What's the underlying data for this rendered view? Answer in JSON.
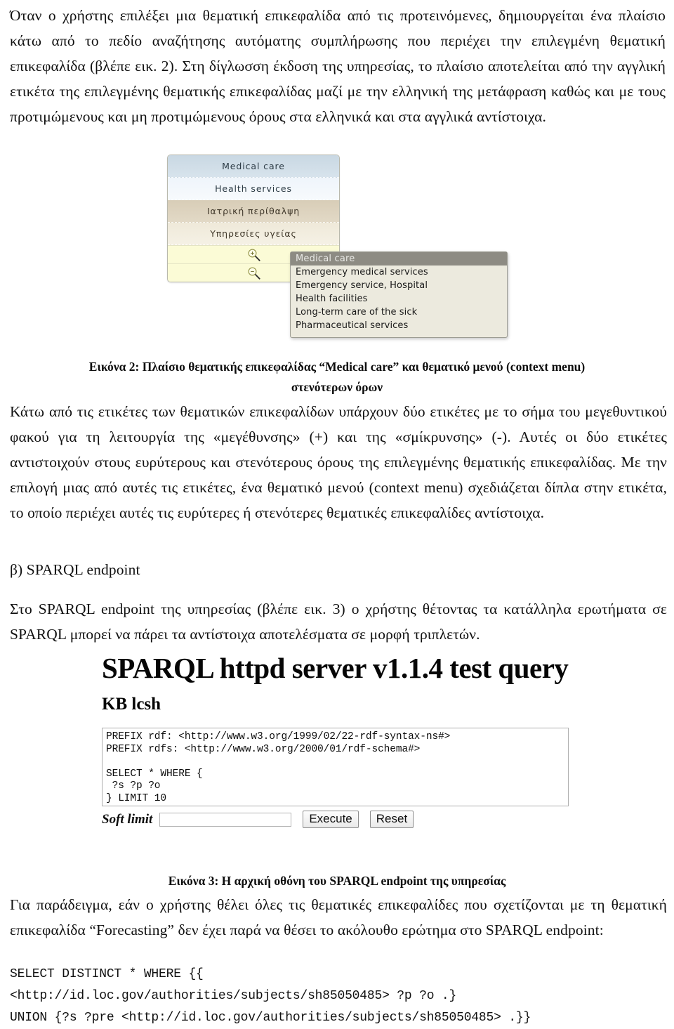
{
  "document": {
    "paragraph_1": "Όταν ο χρήστης επιλέξει μια θεματική επικεφαλίδα από τις προτεινόμενες, δημιουργείται ένα πλαίσιο κάτω από το πεδίο αναζήτησης αυτόματης συμπλήρωσης που περιέχει την επιλεγμένη θεματική επικεφαλίδα (βλέπε εικ. 2). Στη δίγλωσση έκδοση της υπηρεσίας, το πλαίσιο αποτελείται από την αγγλική ετικέτα της επιλεγμένης θεματικής επικεφαλίδας μαζί με την ελληνική της μετάφραση καθώς και με τους προτιμώμενους και μη προτιμώμενους όρους στα ελληνικά και στα αγγλικά αντίστοιχα.",
    "figure_2_caption_line_1": "Εικόνα 2: Πλαίσιο θεματικής επικεφαλίδας “Medical care” και θεματικό μενού (context menu)",
    "figure_2_caption_line_2": "στενότερων όρων",
    "paragraph_2": "Κάτω από τις ετικέτες των θεματικών επικεφαλίδων υπάρχουν δύο ετικέτες με το σήμα του μεγεθυντικού φακού για τη λειτουργία της «μεγέθυνσης» (+) και της «σμίκρυνσης» (-). Αυτές οι δύο ετικέτες αντιστοιχούν στους ευρύτερους και στενότερους όρους της επιλεγμένης θεματικής επικεφαλίδας. Με την επιλογή μιας από αυτές τις ετικέτες,  ένα θεματικό μενού (context menu) σχεδιάζεται δίπλα στην ετικέτα, το οποίο περιέχει αυτές τις ευρύτερες ή στενότερες θεματικές επικεφαλίδες αντίστοιχα.",
    "section_heading_b": "β) SPARQL endpoint",
    "paragraph_3": "Στο SPARQL endpoint της υπηρεσίας (βλέπε εικ. 3) ο χρήστης θέτοντας τα κατάλληλα ερωτήματα σε SPARQL μπορεί να πάρει τα αντίστοιχα αποτελέσματα σε μορφή τριπλετών.",
    "figure_3_caption": "Εικόνα 3: Η αρχική οθόνη του SPARQL endpoint της υπηρεσίας",
    "paragraph_4": "Για παράδειγμα, εάν ο χρήστης θέλει όλες τις θεματικές επικεφαλίδες που σχετίζονται με τη θεματική επικεφαλίδα “Forecasting” δεν έχει παρά να θέσει το ακόλουθο ερώτημα στο SPARQL endpoint:",
    "code_block": "SELECT DISTINCT * WHERE {{\n<http://id.loc.gov/authorities/subjects/sh85050485> ?p ?o .}\nUNION {?s ?pre <http://id.loc.gov/authorities/subjects/sh85050485> .}}"
  },
  "figure_2": {
    "autocomplete_panel": {
      "rows": [
        {
          "label": "Medical care",
          "bg": "#c9d8e3"
        },
        {
          "label": "Health services",
          "bg": "#eff5fb"
        },
        {
          "label": "Ιατρική περίθαλψη",
          "bg": "#d8cdb7"
        },
        {
          "label": "Υπηρεσίες υγείας",
          "bg": "#efe9d9"
        }
      ],
      "zoom_in_icon": "magnifier-plus-icon",
      "zoom_out_icon": "magnifier-minus-icon",
      "zoom_row_bg": "#fbfbd6"
    },
    "context_menu": {
      "header": "Medical care",
      "header_bg": "#8d8b83",
      "header_fg": "#e9e9e6",
      "body_bg": "#eceade",
      "items": [
        "Emergency medical services",
        "Emergency service, Hospital",
        "Health facilities",
        "Long-term care of the sick",
        "Pharmaceutical services"
      ]
    }
  },
  "figure_3": {
    "title": "SPARQL httpd server v1.1.4 test query",
    "kb_heading": "KB lcsh",
    "query_textarea_value": "PREFIX rdf: <http://www.w3.org/1999/02/22-rdf-syntax-ns#>\nPREFIX rdfs: <http://www.w3.org/2000/01/rdf-schema#>\n\nSELECT * WHERE {\n ?s ?p ?o\n} LIMIT 10",
    "soft_limit_label": "Soft limit",
    "soft_limit_value": "",
    "soft_limit_placeholder": "",
    "execute_button": "Execute",
    "reset_button": "Reset",
    "resize_grip_icon": "resize-handle-icon"
  }
}
